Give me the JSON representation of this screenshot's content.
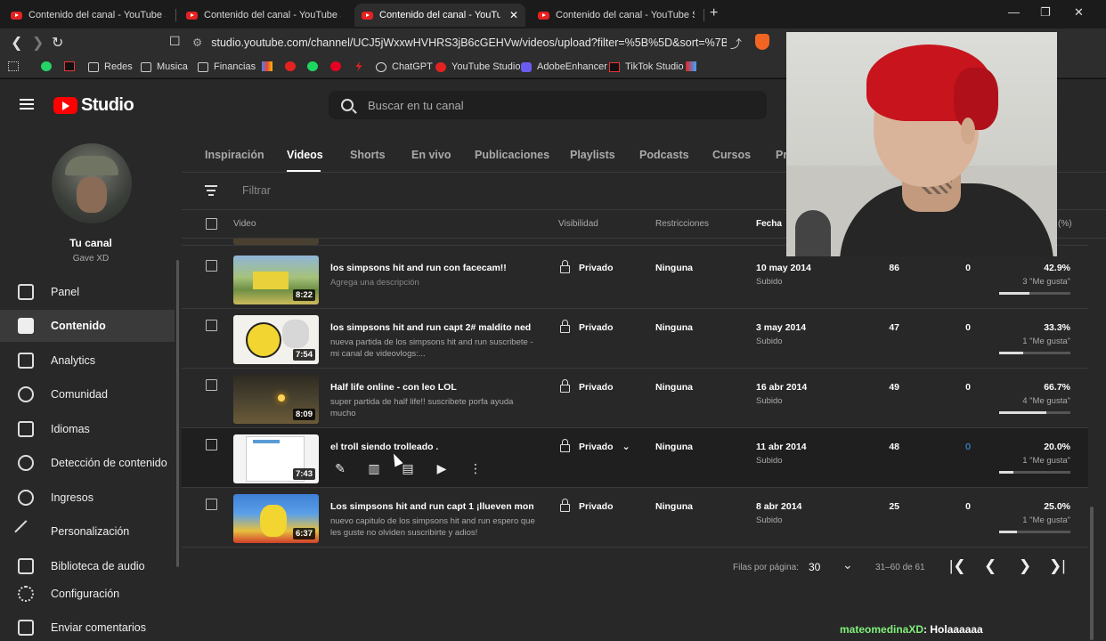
{
  "browser": {
    "tabs": [
      {
        "title": "Contenido del canal - YouTube Studio",
        "active": false
      },
      {
        "title": "Contenido del canal - YouTube Studio",
        "active": false
      },
      {
        "title": "Contenido del canal - YouTube Studio",
        "active": true
      },
      {
        "title": "Contenido del canal - YouTube Studio",
        "active": false
      }
    ],
    "new_tab": "+",
    "address": "studio.youtube.com/channel/UCJ5jWxxwHVHRS3jB6cGEHVw/videos/upload?filter=%5B%5D&sort=%7B\"column...",
    "bookmarks": [
      "Redes",
      "Musica",
      "Financias",
      "ChatGPT",
      "YouTube Studio",
      "AdobeEnhancer",
      "TikTok Studio"
    ]
  },
  "header": {
    "logo_text": "Studio",
    "search_placeholder": "Buscar en tu canal"
  },
  "channel": {
    "name": "Tu canal",
    "handle": "Gave XD"
  },
  "nav": [
    {
      "label": "Panel",
      "icon": "dashboard-icon",
      "active": false
    },
    {
      "label": "Contenido",
      "icon": "content-icon",
      "active": true
    },
    {
      "label": "Analytics",
      "icon": "analytics-icon",
      "active": false
    },
    {
      "label": "Comunidad",
      "icon": "community-icon",
      "active": false
    },
    {
      "label": "Idiomas",
      "icon": "subtitles-icon",
      "active": false
    },
    {
      "label": "Detección de contenido",
      "icon": "copyright-icon",
      "active": false
    },
    {
      "label": "Ingresos",
      "icon": "dollar-icon",
      "active": false
    },
    {
      "label": "Personalización",
      "icon": "wand-icon",
      "active": false
    },
    {
      "label": "Biblioteca de audio",
      "icon": "audio-library-icon",
      "active": false
    },
    {
      "label": "Configuración",
      "icon": "gear-icon",
      "active": false
    },
    {
      "label": "Enviar comentarios",
      "icon": "feedback-icon",
      "active": false
    }
  ],
  "content_tabs": [
    {
      "label": "Inspiración",
      "active": false
    },
    {
      "label": "Videos",
      "active": true
    },
    {
      "label": "Shorts",
      "active": false
    },
    {
      "label": "En vivo",
      "active": false
    },
    {
      "label": "Publicaciones",
      "active": false
    },
    {
      "label": "Playlists",
      "active": false
    },
    {
      "label": "Podcasts",
      "active": false
    },
    {
      "label": "Cursos",
      "active": false
    },
    {
      "label": "Pr",
      "active": false
    }
  ],
  "filter_placeholder": "Filtrar",
  "table": {
    "headers": {
      "video": "Video",
      "visibility": "Visibilidad",
      "restrictions": "Restricciones",
      "date": "Fecha",
      "likes_pct": "(%)"
    },
    "rows": [
      {
        "title": "los simpsons hit and run con facecam!!",
        "description": "Agrega una descripción",
        "duration": "8:22",
        "visibility": "Privado",
        "restrictions": "Ninguna",
        "date": "10 may 2014",
        "status": "Subido",
        "views": "86",
        "comments": "0",
        "likes_pct": "42.9%",
        "likes_count": "3 \"Me gusta\"",
        "likes_ratio": 0.429
      },
      {
        "title": "los simpsons hit and run capt 2# maldito ned ...",
        "description": "nueva partida de los simpsons hit and run suscribete -mi canal de videovlogs:...",
        "duration": "7:54",
        "visibility": "Privado",
        "restrictions": "Ninguna",
        "date": "3 may 2014",
        "status": "Subido",
        "views": "47",
        "comments": "0",
        "likes_pct": "33.3%",
        "likes_count": "1 \"Me gusta\"",
        "likes_ratio": 0.333
      },
      {
        "title": "Half life online - con leo LOL",
        "description": "super partida de half life!! suscribete porfa ayuda mucho",
        "duration": "8:09",
        "visibility": "Privado",
        "restrictions": "Ninguna",
        "date": "16 abr 2014",
        "status": "Subido",
        "views": "49",
        "comments": "0",
        "likes_pct": "66.7%",
        "likes_count": "4 \"Me gusta\"",
        "likes_ratio": 0.667
      },
      {
        "title": "el troll siendo trolleado .",
        "description": "",
        "duration": "7:43",
        "visibility": "Privado",
        "restrictions": "Ninguna",
        "date": "11 abr 2014",
        "status": "Subido",
        "views": "48",
        "comments": "0",
        "likes_pct": "20.0%",
        "likes_count": "1 \"Me gusta\"",
        "likes_ratio": 0.2
      },
      {
        "title": "Los simpsons hit and run capt 1 ¡llueven mone...",
        "description": "nuevo capitulo de los simpsons hit and run espero que les guste no olviden suscribirte y adios!",
        "duration": "6:37",
        "visibility": "Privado",
        "restrictions": "Ninguna",
        "date": "8 abr 2014",
        "status": "Subido",
        "views": "25",
        "comments": "0",
        "likes_pct": "25.0%",
        "likes_count": "1 \"Me gusta\"",
        "likes_ratio": 0.25
      }
    ]
  },
  "pager": {
    "rows_per_page_label": "Filas por página:",
    "rows_per_page": "30",
    "range": "31–60 de 61"
  },
  "chat": {
    "user": "mateomedinaXD",
    "message": ": Holaaaaaa"
  },
  "colors": {
    "accent_red": "#ff0000",
    "link_blue": "#3ea6ff",
    "chat_user": "#7ff07a"
  }
}
